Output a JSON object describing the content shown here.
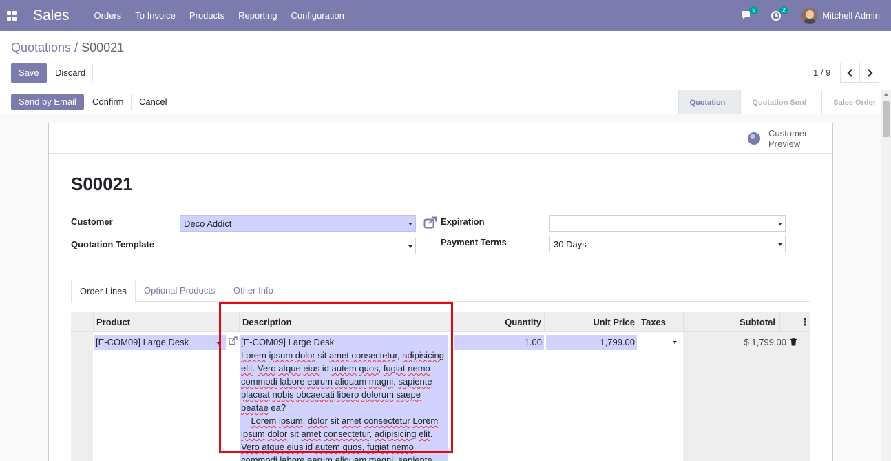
{
  "navbar": {
    "app_name": "Sales",
    "menu": [
      "Orders",
      "To Invoice",
      "Products",
      "Reporting",
      "Configuration"
    ],
    "messages_count": "5",
    "activities_count": "2",
    "user_name": "Mitchell Admin"
  },
  "breadcrumb": {
    "parent": "Quotations",
    "separator": " / ",
    "current": "S00021"
  },
  "form_buttons": {
    "save": "Save",
    "discard": "Discard"
  },
  "pager": {
    "text": "1 / 9"
  },
  "header_buttons": {
    "send": "Send by Email",
    "confirm": "Confirm",
    "cancel": "Cancel"
  },
  "stages": [
    "Quotation",
    "Quotation Sent",
    "Sales Order"
  ],
  "button_box": {
    "customer_preview": "Customer Preview"
  },
  "order": {
    "name": "S00021",
    "customer_label": "Customer",
    "customer_value": "Deco Addict",
    "template_label": "Quotation Template",
    "template_value": "",
    "expiration_label": "Expiration",
    "expiration_value": "",
    "payment_terms_label": "Payment Terms",
    "payment_terms_value": "30 Days"
  },
  "tabs": [
    "Order Lines",
    "Optional Products",
    "Other Info"
  ],
  "table": {
    "headers": {
      "product": "Product",
      "description": "Description",
      "quantity": "Quantity",
      "unit_price": "Unit Price",
      "taxes": "Taxes",
      "subtotal": "Subtotal"
    },
    "row": {
      "product": "[E-COM09] Large Desk",
      "description_first": "[E-COM09] Large Desk",
      "quantity": "1.00",
      "unit_price": "1,799.00",
      "subtotal": "$ 1,799.00"
    }
  },
  "colors": {
    "primary": "#7c7bad",
    "field_bg": "#d2d2ff",
    "highlight": "#e30613"
  }
}
